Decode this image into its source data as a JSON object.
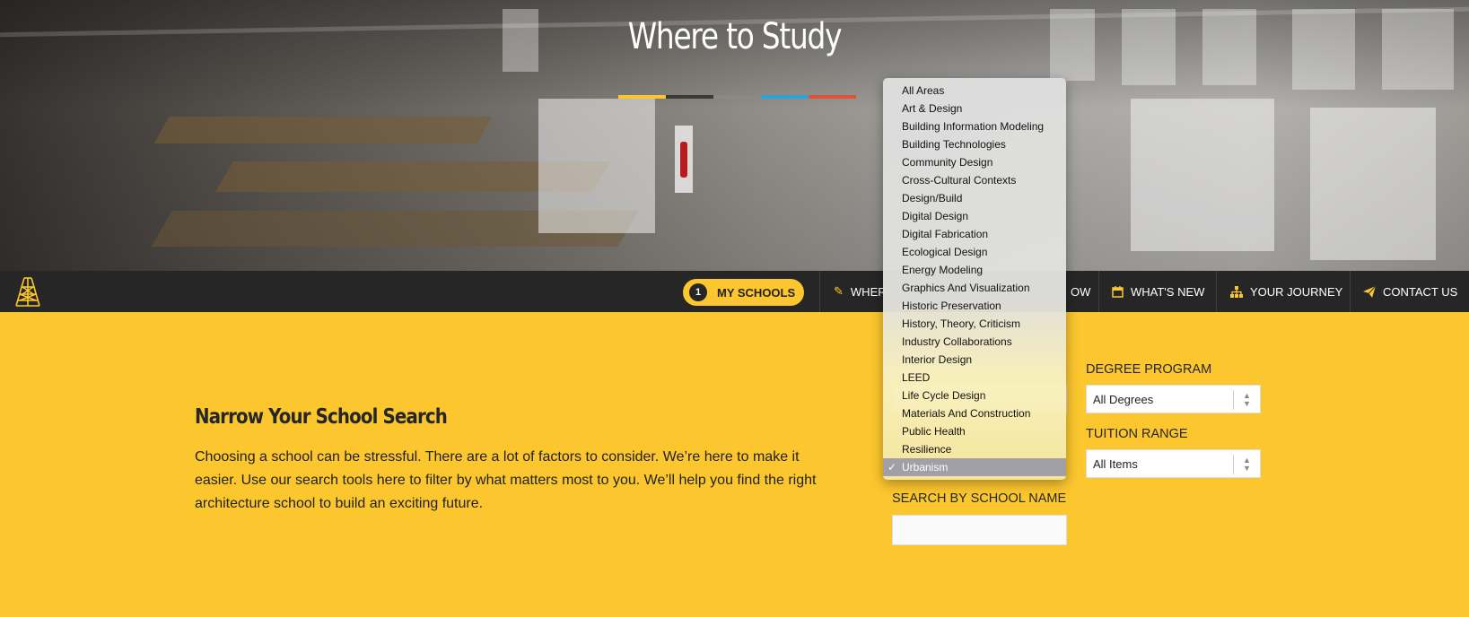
{
  "hero": {
    "title": "Where to Study",
    "bar_colors": [
      "#fcc72e",
      "#3b3b33",
      "#8a8a84",
      "#2aa3d6",
      "#e1523d"
    ]
  },
  "nav": {
    "my_schools": {
      "count": "1",
      "label": "MY SCHOOLS"
    },
    "items": [
      {
        "label": "WHER",
        "icon": "pencil-icon"
      },
      {
        "label": "OW",
        "icon": ""
      },
      {
        "label": "WHAT'S NEW",
        "icon": "calendar-icon"
      },
      {
        "label": "YOUR JOURNEY",
        "icon": "sitemap-icon"
      },
      {
        "label": "CONTACT US",
        "icon": "paper-plane-icon"
      }
    ]
  },
  "content": {
    "title": "Narrow Your School Search",
    "intro": "Choosing a school can be stressful. There are a lot of factors to consider. We’re here to make it easier. Use our search tools here to filter by what matters most to you. We’ll help you find the right architecture school to build an exciting future."
  },
  "filters": {
    "degree_label": "DEGREE PROGRAM",
    "degree_value": "All Degrees",
    "tuition_label": "TUITION RANGE",
    "tuition_value": "All Items",
    "search_label": "SEARCH BY SCHOOL NAME",
    "search_value": ""
  },
  "dropdown": {
    "selected": "Urbanism",
    "check": "✓",
    "options": [
      "All Areas",
      "Art & Design",
      "Building Information Modeling",
      "Building Technologies",
      "Community Design",
      "Cross-Cultural Contexts",
      "Design/Build",
      "Digital Design",
      "Digital Fabrication",
      "Ecological Design",
      "Energy Modeling",
      "Graphics And Visualization",
      "Historic Preservation",
      "History, Theory, Criticism",
      "Industry Collaborations",
      "Interior Design",
      "LEED",
      "Life Cycle Design",
      "Materials And Construction",
      "Public Health",
      "Resilience",
      "Urbanism"
    ]
  }
}
